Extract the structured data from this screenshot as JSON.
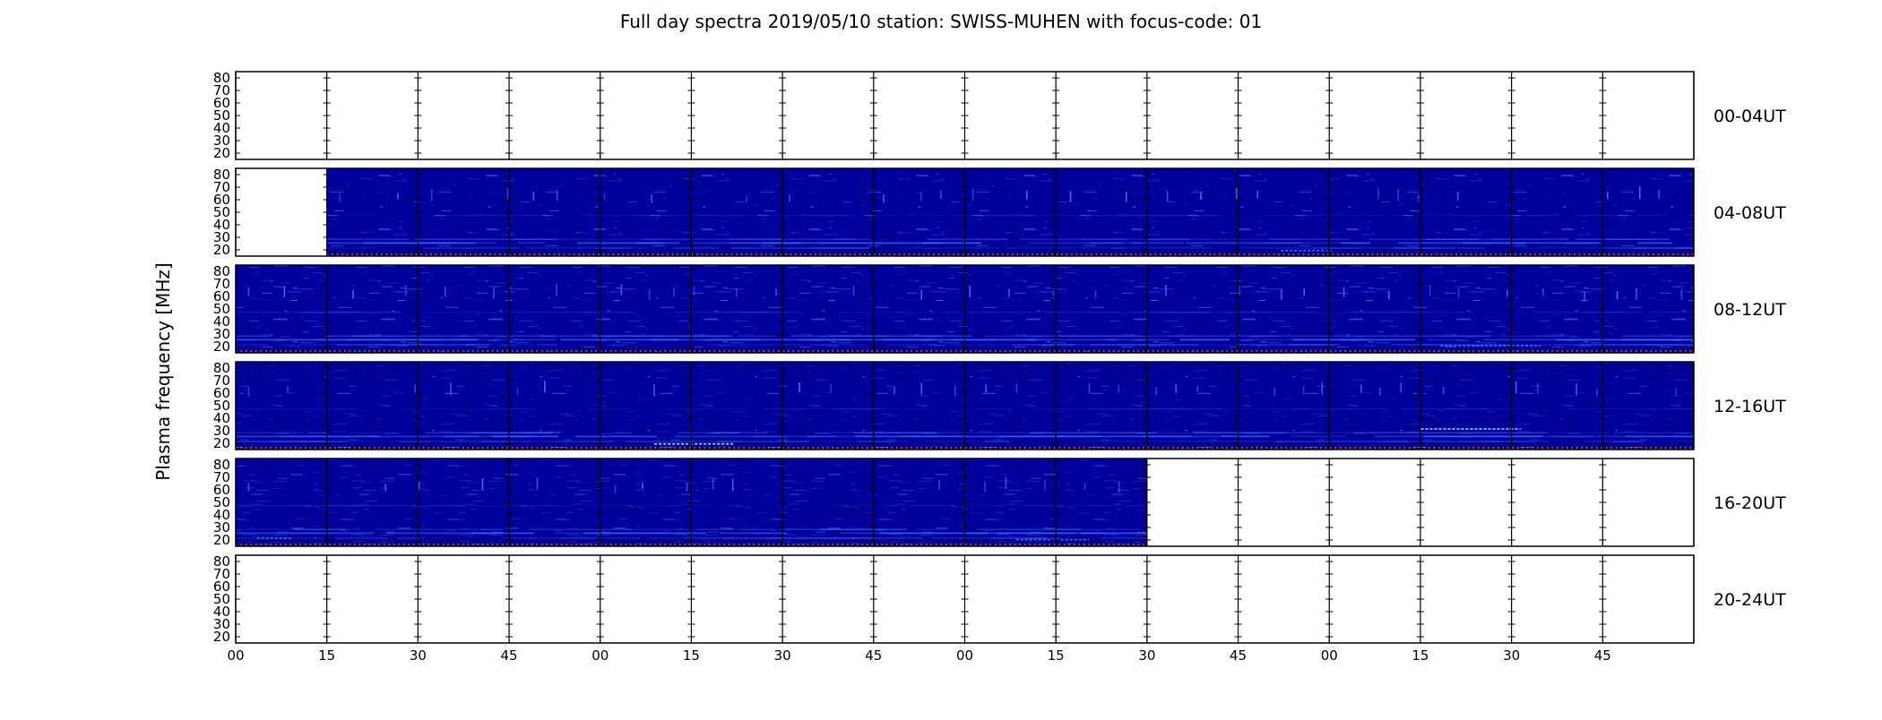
{
  "chart_data": {
    "type": "heatmap",
    "title": "Full day spectra 2019/05/10 station: SWISS-MUHEN with focus-code: 01",
    "ylabel": "Plasma frequency [MHz]",
    "ytick_labels": [
      "20",
      "30",
      "40",
      "50",
      "60",
      "70",
      "80"
    ],
    "yticks": [
      20,
      30,
      40,
      50,
      60,
      70,
      80
    ],
    "ylim": [
      15,
      85
    ],
    "xtick_labels": [
      "00",
      "15",
      "30",
      "45",
      "00",
      "15",
      "30",
      "45",
      "00",
      "15",
      "30",
      "45",
      "00",
      "15",
      "30",
      "45"
    ],
    "xlim_minutes": [
      0,
      240
    ],
    "segment_minutes": 15,
    "grid": false,
    "colors": {
      "background": "#00009a",
      "dark": "#000070",
      "emission": "#3c6cff",
      "bright": "#9ee8ff",
      "hot": "#ff3b1a",
      "frame": "#000000"
    },
    "panels": [
      {
        "label": "00-04UT",
        "data_minutes": []
      },
      {
        "label": "04-08UT",
        "data_minutes": [
          [
            15,
            240
          ]
        ]
      },
      {
        "label": "08-12UT",
        "data_minutes": [
          [
            0,
            240
          ]
        ]
      },
      {
        "label": "12-16UT",
        "data_minutes": [
          [
            0,
            240
          ]
        ]
      },
      {
        "label": "16-20UT",
        "data_minutes": [
          [
            0,
            150
          ]
        ]
      },
      {
        "label": "20-24UT",
        "data_minutes": []
      }
    ]
  }
}
